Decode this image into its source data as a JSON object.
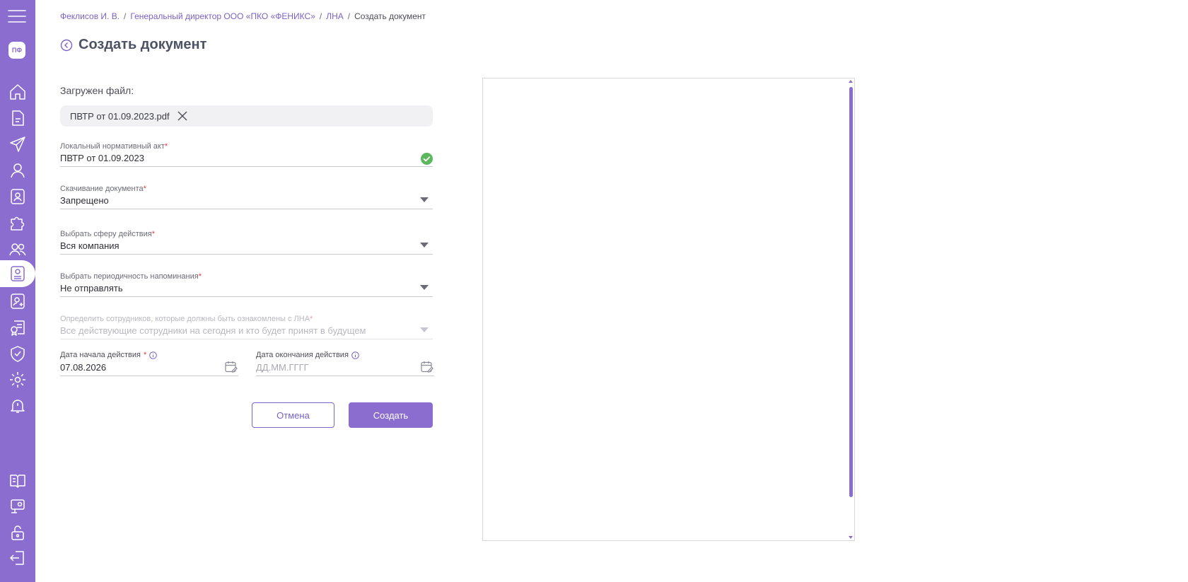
{
  "app": {
    "logo_text": "ПФ",
    "accent": "#8a6dcf"
  },
  "sidebar": {
    "top_icons": [
      "home-icon",
      "document-icon",
      "send-icon",
      "user-icon",
      "user-badge-icon",
      "puzzle-icon",
      "team-icon",
      "lna-book-icon",
      "user-add-icon",
      "certificate-icon",
      "shield-check-icon",
      "gear-icon",
      "bell-alert-icon"
    ],
    "bottom_icons": [
      "book-open-icon",
      "presentation-icon",
      "unlock-icon",
      "logout-icon"
    ]
  },
  "breadcrumb": {
    "items": [
      "Феклисов И. В.",
      "Генеральный директор ООО «ПКО «ФЕНИКС»",
      "ЛНА"
    ],
    "current": "Создать документ",
    "separator": "/"
  },
  "page": {
    "title": "Создать документ"
  },
  "upload": {
    "label": "Загружен файл:",
    "file_name": "ПВТР от 01.09.2023.pdf"
  },
  "fields": {
    "lna": {
      "label": "Локальный нормативный акт",
      "required_mark": "*",
      "value": "ПВТР от 01.09.2023"
    },
    "download": {
      "label": "Скачивание документа",
      "required_mark": "*",
      "value": "Запрещено"
    },
    "scope": {
      "label": "Выбрать сферу действия",
      "required_mark": "*",
      "value": "Вся компания"
    },
    "reminder": {
      "label": "Выбрать периодичность напоминания",
      "required_mark": "*",
      "value": "Не отправлять"
    },
    "employees": {
      "label": "Определить сотрудников, которые должны быть ознакомлены с ЛНА",
      "required_mark": "*",
      "value": "Все действующие сотрудники на сегодня и кто будет принят в будущем"
    },
    "start_date": {
      "label": "Дата начала действия",
      "required_mark": " *",
      "value": "07.08.2026"
    },
    "end_date": {
      "label": "Дата окончания действия",
      "placeholder": "ДД.ММ.ГГГГ"
    }
  },
  "buttons": {
    "cancel": "Отмена",
    "create": "Создать"
  }
}
